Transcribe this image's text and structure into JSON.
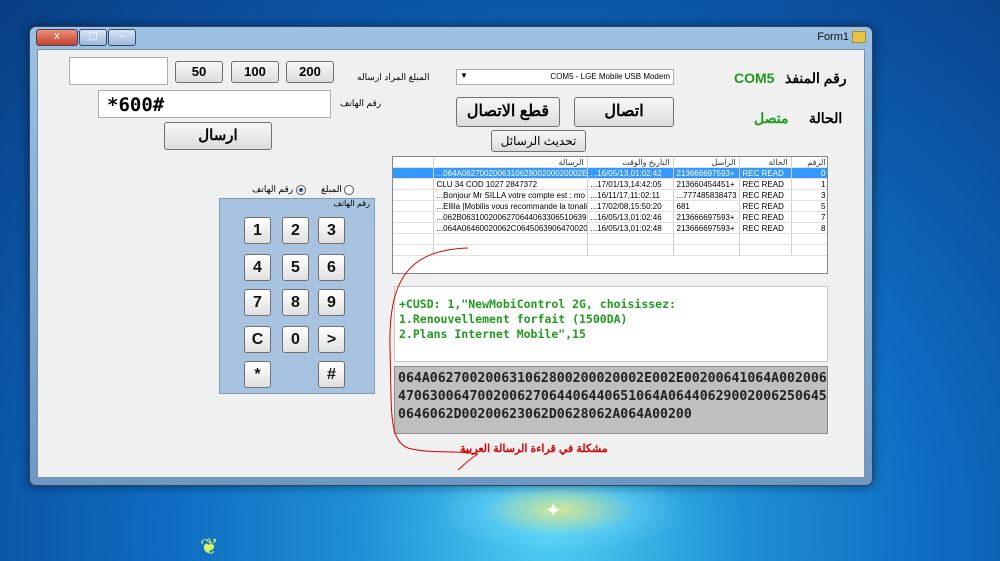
{
  "window": {
    "title": "Form1",
    "controls": [
      "x",
      "□",
      "‒"
    ]
  },
  "amount_buttons": [
    "50",
    "100",
    "200"
  ],
  "labels": {
    "amount_to_send": "المبلغ المراد ارساله",
    "phone_number": "رقم الهاتف",
    "port_number": "رقم المنفذ",
    "port_value": "COM5",
    "status": "الحالة",
    "status_value": "متصل",
    "radio_amount": "المبلغ",
    "radio_phone": "رقم الهاتف",
    "keypad_group": "رقم الهاتف"
  },
  "inputs": {
    "amount_value": "",
    "phone_value": "*600#"
  },
  "buttons": {
    "send": "ارسال",
    "connect": "اتصال",
    "disconnect": "قطع الاتصال",
    "refresh": "تحديث الرسائل"
  },
  "port_select": {
    "selected": "COM5 - LGE Mobile USB Modem"
  },
  "messages_table": {
    "columns": [
      "الرسالة",
      "التاريخ والوقت",
      "الراسل",
      "الحالة",
      "الرقم"
    ],
    "rows": [
      [
        "...064A062700200631062800200020002E002E",
        "...16/05/13,01:02:42",
        "213666697593+",
        "REC READ",
        "0"
      ],
      [
        "CLU 34      COD 1027  2847372",
        "...17/01/13,14:42:05",
        "213660454451+",
        "REC READ",
        "1"
      ],
      [
        "...Bonjour Mr SILLA votre compte est : mo",
        "...16/11/17,11:02:11",
        "...777485838473",
        "REC READ",
        "3"
      ],
      [
        "...Ellila  |Mobilis vous recommande la tonalit",
        "...17/02/08,15:50:20",
        "681",
        "REC READ",
        "5"
      ],
      [
        "...062B0631002006270644063306510639",
        "...16/05/13,01:02:46",
        "213666697593+",
        "REC READ",
        "7"
      ],
      [
        "...064A06460020062C0645063906470020",
        "...16/05/13,01:02:48",
        "213666697593+",
        "REC READ",
        "8"
      ]
    ]
  },
  "response_lines": [
    "+CUSD: 1,\"NewMobiControl 2G, choisissez:",
    "1.Renouvellement forfait (1500DA)",
    "2.Plans Internet Mobile\",15"
  ],
  "hex_text": "064A062700200631062800200020002E002E00200641064A002006470630064700200627064406440651064A064406290020062506450646062D00200623062D0628062A064A00200",
  "keypad_keys": [
    "1",
    "2",
    "3",
    "4",
    "5",
    "6",
    "7",
    "8",
    "9",
    "C",
    "0",
    ">",
    "*",
    "#"
  ],
  "annotation": "مشكلة في قراءة الرسالة العربية",
  "colors": {
    "status_green": "#1a9b1a",
    "port_green": "#1a9b1a",
    "selection_blue": "#3399ff",
    "annotation_red": "#d40000"
  }
}
